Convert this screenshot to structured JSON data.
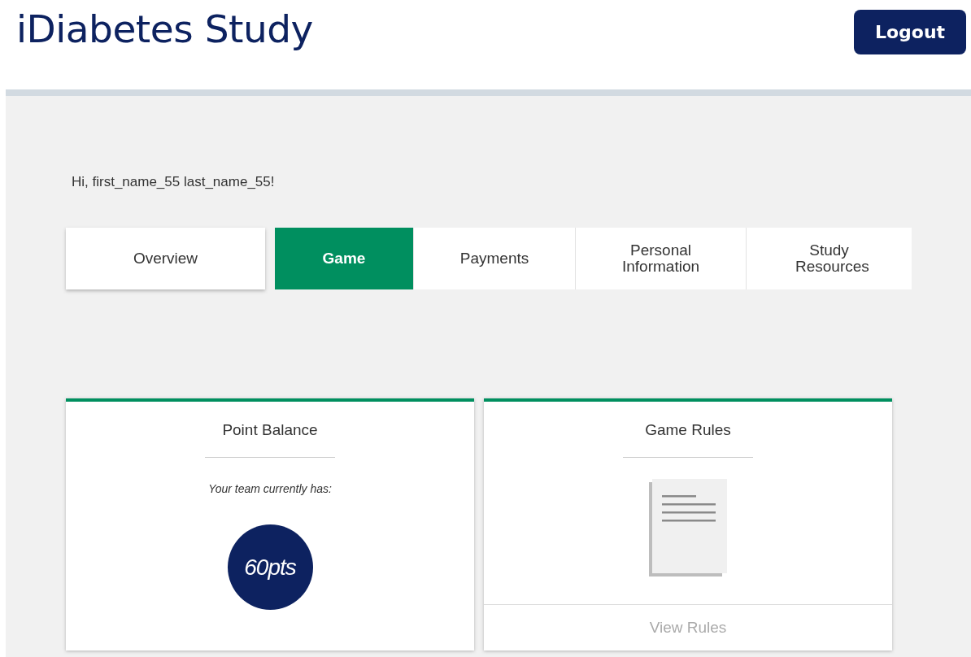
{
  "header": {
    "title": "iDiabetes Study",
    "logout": "Logout"
  },
  "greeting": "Hi, first_name_55 last_name_55!",
  "tabs": [
    {
      "label": "Overview",
      "selected": false
    },
    {
      "label": "Game",
      "selected": true
    },
    {
      "label": "Payments",
      "selected": false
    },
    {
      "label": "Personal Information",
      "selected": false
    },
    {
      "label": "Study Resources",
      "selected": false
    }
  ],
  "cards": [
    {
      "kind": "points",
      "title": "Point Balance",
      "subtitle": "Your team currently has:",
      "value": "60pts"
    },
    {
      "kind": "rules",
      "title": "Game Rules",
      "link": "View Rules"
    }
  ]
}
